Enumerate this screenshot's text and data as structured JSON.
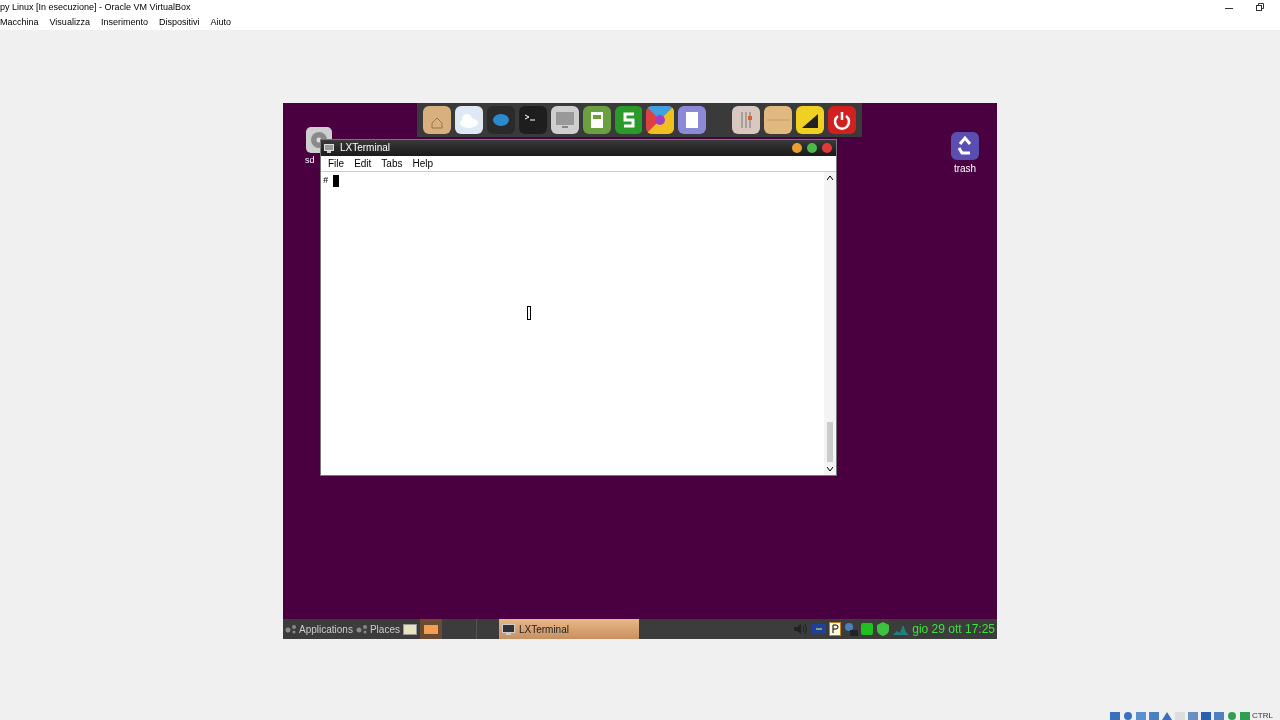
{
  "window": {
    "title": "py Linux [In esecuzione] - Oracle VM VirtualBox",
    "menu": [
      "Macchina",
      "Visualizza",
      "Inserimento",
      "Dispositivi",
      "Aiuto"
    ]
  },
  "desktop": {
    "icons": [
      {
        "label": "sd"
      },
      {
        "label": "trash"
      }
    ]
  },
  "terminal": {
    "title": "LXTerminal",
    "menu": [
      "File",
      "Edit",
      "Tabs",
      "Help"
    ],
    "prompt": "#"
  },
  "taskbar": {
    "applications": "Applications",
    "places": "Places",
    "tasks": [
      {
        "label": "LXTerminal",
        "selected": true
      }
    ],
    "clock": "gio 29 ott 17:25"
  },
  "status_bar": {
    "host_key": "CTRL"
  }
}
